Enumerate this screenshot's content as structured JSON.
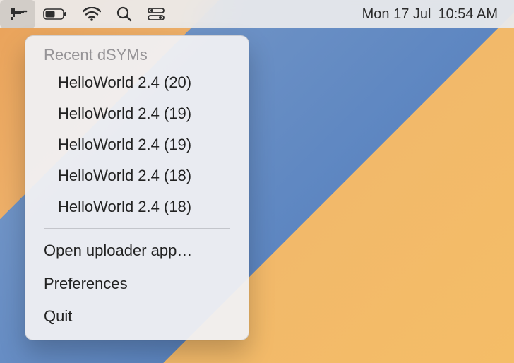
{
  "menubar": {
    "status_icons": {
      "app": "sentry-gun-icon",
      "battery": "battery-icon",
      "wifi": "wifi-icon",
      "search": "search-icon",
      "control_center": "control-center-icon"
    },
    "date": "Mon 17 Jul",
    "time": "10:54 AM"
  },
  "dropdown": {
    "section_header": "Recent dSYMs",
    "recent_items": [
      {
        "label": "HelloWorld 2.4 (20)"
      },
      {
        "label": "HelloWorld 2.4 (19)"
      },
      {
        "label": "HelloWorld 2.4 (19)"
      },
      {
        "label": "HelloWorld 2.4 (18)"
      },
      {
        "label": "HelloWorld 2.4 (18)"
      }
    ],
    "actions": {
      "open_uploader": "Open uploader app…",
      "preferences": "Preferences",
      "quit": "Quit"
    }
  }
}
